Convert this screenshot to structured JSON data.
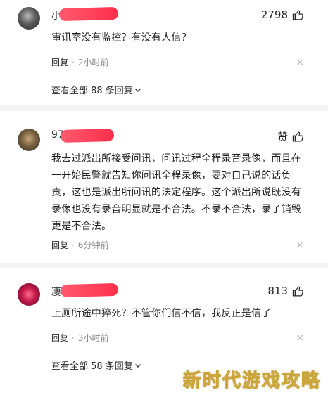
{
  "comments": [
    {
      "name": "小",
      "likes": "2798",
      "text": "审讯室没有监控？有没有人信？",
      "reply_label": "回复",
      "dot": "·",
      "time": "2小时前",
      "close": "×",
      "view_all": "查看全部 88 条回复"
    },
    {
      "name": "97",
      "likes": "赞",
      "text": "我去过派出所接受问讯，问讯过程全程录音录像，而且在一开始民警就告知你问讯全程录像，要对自己说的话负责，这也是派出所问讯的法定程序。这个派出所说既没有录像也没有录音明显就是不合法。不录不合法，录了销毁更是不合法。",
      "reply_label": "回复",
      "dot": "·",
      "time": "6分钟前",
      "close": "×"
    },
    {
      "name": "凄",
      "likes": "813",
      "text": "上厕所途中猝死？不管你们信不信，我反正是信了",
      "reply_label": "回复",
      "dot": "·",
      "time": "3小时前",
      "close": "×",
      "view_all": "查看全部 58 条回复"
    }
  ],
  "watermark": "新时代游戏攻略",
  "accent_redaction": "#ff2f4a"
}
